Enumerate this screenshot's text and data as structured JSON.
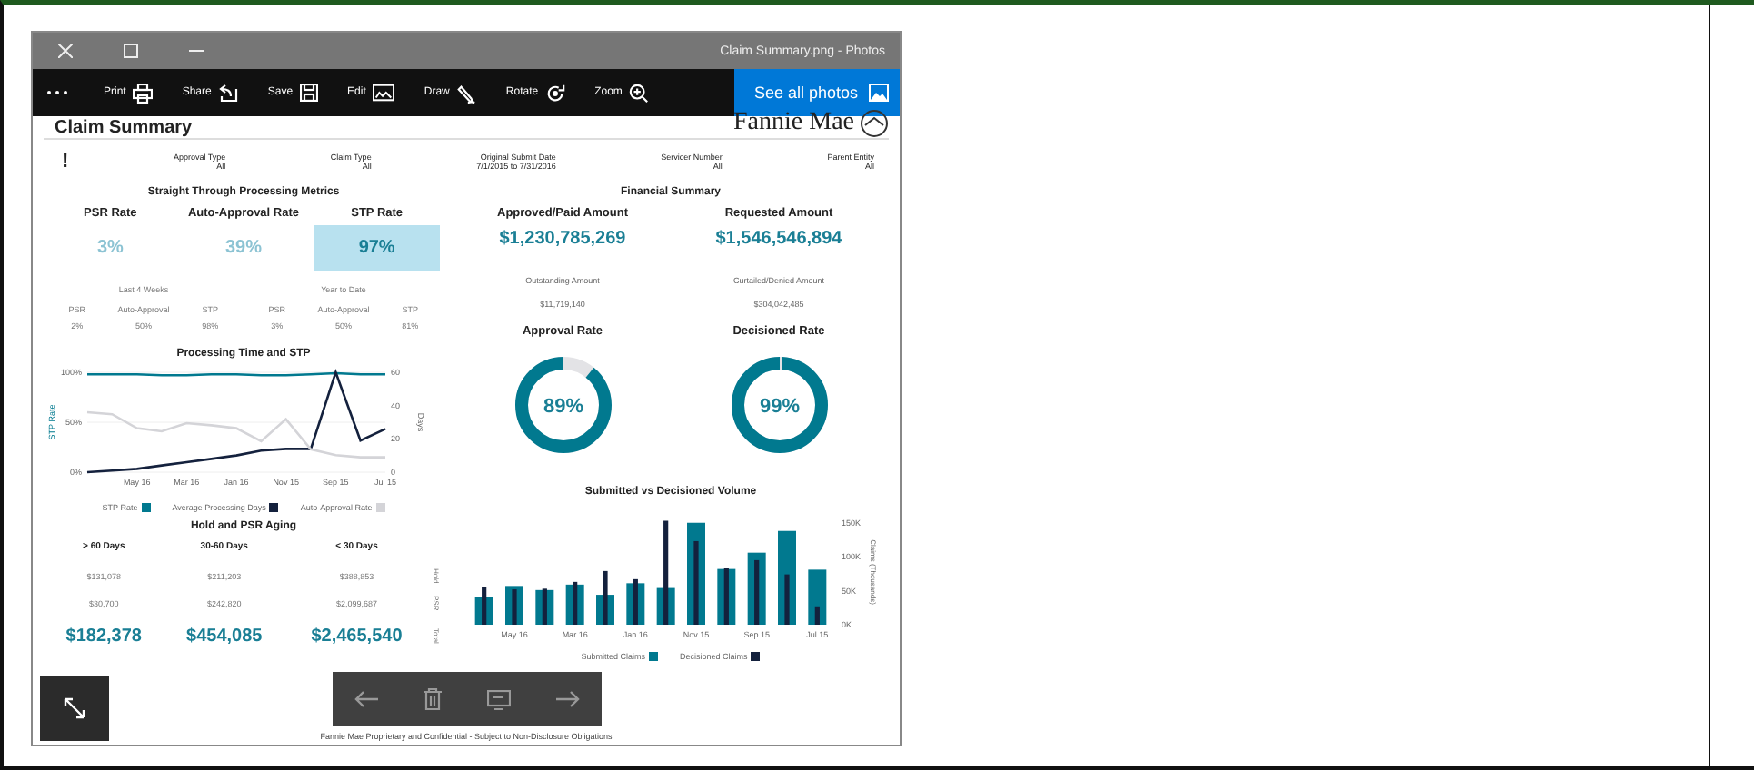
{
  "window": {
    "title": "Claim Summary.png - Photos"
  },
  "toolbar": {
    "tools": [
      {
        "label": "Print",
        "kind": "print"
      },
      {
        "label": "Share",
        "kind": "share"
      },
      {
        "label": "Save",
        "kind": "save"
      },
      {
        "label": "Edit",
        "kind": "edit"
      },
      {
        "label": "Draw",
        "kind": "draw"
      },
      {
        "label": "Rotate",
        "kind": "rotate"
      },
      {
        "label": "Zoom",
        "kind": "zoom"
      }
    ],
    "home_button": "See all photos"
  },
  "dashboard": {
    "title": "Claim Summary",
    "logo": "Fannie Mae",
    "alert": "!",
    "filters": [
      {
        "label": "Approval Type",
        "value": "All"
      },
      {
        "label": "Claim Type",
        "value": "All"
      },
      {
        "label": "Original Submit Date",
        "value": "7/1/2015 to 7/31/2016"
      },
      {
        "label": "Servicer Number",
        "value": "All"
      },
      {
        "label": "Parent Entity",
        "value": "All"
      }
    ],
    "stp": {
      "title": "Straight Through Processing Metrics",
      "metrics": [
        {
          "label": "PSR Rate",
          "value": "3%",
          "selected": false
        },
        {
          "label": "Auto-Approval Rate",
          "value": "39%",
          "selected": false
        },
        {
          "label": "STP Rate",
          "value": "97%",
          "selected": true
        }
      ],
      "periods": [
        {
          "title": "Last 4 Weeks",
          "items": [
            {
              "label": "PSR",
              "value": "2%"
            },
            {
              "label": "Auto-Approval",
              "value": "50%"
            },
            {
              "label": "STP",
              "value": "98%"
            }
          ]
        },
        {
          "title": "Year to Date",
          "items": [
            {
              "label": "PSR",
              "value": "3%"
            },
            {
              "label": "Auto-Approval",
              "value": "50%"
            },
            {
              "label": "STP",
              "value": "81%"
            }
          ]
        }
      ]
    },
    "processing_chart": {
      "title": "Processing Time and STP",
      "chart_data": {
        "type": "line",
        "ylabel": "STP Rate",
        "y2label": "Days",
        "y2lim": [
          0,
          60
        ],
        "y2ticks": [
          0,
          20,
          40,
          60
        ],
        "categories": [
          null,
          null,
          "May 16",
          null,
          "Mar 16",
          null,
          "Jan 16",
          null,
          "Nov 15",
          null,
          "Sep 15",
          null,
          "Jul 15"
        ],
        "ylim": [
          0,
          100
        ],
        "yticks": [
          {
            "value": 0,
            "label": "0%"
          },
          {
            "value": 50,
            "label": "50%"
          },
          {
            "value": 100,
            "label": "100%"
          }
        ],
        "series": [
          {
            "name": "STP Rate",
            "color": "#01798f",
            "values": [
              98,
              98,
              98,
              97,
              97,
              98,
              98,
              97,
              97,
              98,
              99,
              98,
              98
            ]
          },
          {
            "name": "Average Processing Days",
            "color": "#14213d",
            "axis": "y2",
            "values": [
              0,
              1,
              2,
              4,
              6,
              8,
              10,
              13,
              14,
              14,
              60,
              19,
              26
            ]
          },
          {
            "name": "Auto-Approval Rate",
            "color": "#d4d4d8",
            "values": [
              60,
              58,
              44,
              41,
              49,
              47,
              44,
              31,
              53,
              23,
              17,
              15,
              15
            ]
          }
        ]
      }
    },
    "aging": {
      "title": "Hold and PSR Aging",
      "columns": [
        "> 60 Days",
        "30-60 Days",
        "< 30 Days"
      ],
      "rows": [
        {
          "label": "Hold",
          "kind": "detail",
          "cells": [
            "$131,078",
            "$211,203",
            "$388,853"
          ]
        },
        {
          "label": "PSR",
          "kind": "detail",
          "cells": [
            "$30,700",
            "$242,820",
            "$2,099,687"
          ]
        },
        {
          "label": "Total",
          "kind": "total",
          "cells": [
            "$182,378",
            "$454,085",
            "$2,465,540"
          ]
        }
      ]
    },
    "financial": {
      "title": "Financial Summary",
      "headline": [
        {
          "label": "Approved/Paid Amount",
          "value": "$1,230,785,269"
        },
        {
          "label": "Requested Amount",
          "value": "$1,546,546,894"
        }
      ],
      "secondary": [
        {
          "label": "Outstanding Amount",
          "value": "$11,719,140"
        },
        {
          "label": "Curtailed/Denied Amount",
          "value": "$304,042,485"
        }
      ]
    },
    "gauges": [
      {
        "title": "Approval Rate",
        "value": "89%",
        "level": 0.89
      },
      {
        "title": "Decisioned Rate",
        "value": "99%",
        "level": 0.99
      }
    ],
    "volume_chart": {
      "title": "Submitted vs Decisioned Volume",
      "chart_data": {
        "type": "bar",
        "ylabel": "Claims (Thousands)",
        "categories": [
          null,
          "May 16",
          null,
          "Mar 16",
          null,
          "Jan 16",
          null,
          "Nov 15",
          null,
          "Sep 15",
          null,
          "Jul 15"
        ],
        "stacked": false,
        "ylim": [
          0,
          155
        ],
        "yticks": [
          {
            "value": 0,
            "label": "0K"
          },
          {
            "value": 50,
            "label": "50K"
          },
          {
            "value": 100,
            "label": "100K"
          },
          {
            "value": 150,
            "label": "150K"
          }
        ],
        "series": [
          {
            "name": "Submitted Claims",
            "color": "#01798f",
            "values": [
              41,
              57,
              51,
              59,
              44,
              61,
              54,
              150,
              82,
              106,
              138,
              81
            ]
          },
          {
            "name": "Decisioned Claims",
            "color": "#14213d",
            "values": [
              56,
              52,
              53,
              63,
              79,
              67,
              153,
              123,
              84,
              95,
              74,
              27
            ]
          }
        ]
      }
    },
    "footer": "Fannie Mae Proprietary and Confidential - Subject to Non-Disclosure Obligations"
  }
}
